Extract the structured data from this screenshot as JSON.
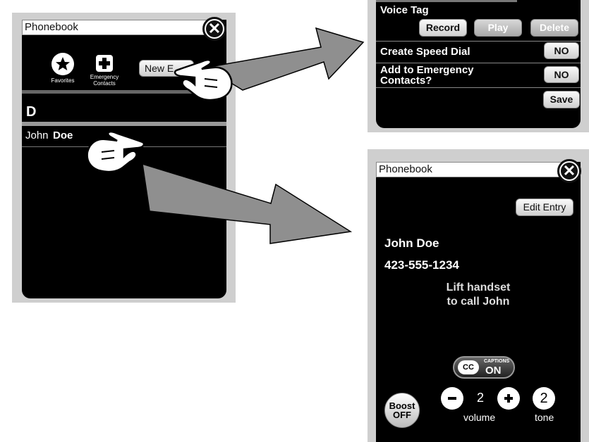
{
  "left_panel": {
    "title": "Phonebook",
    "favorites_label": "Favorites",
    "emergency_label": "Emergency Contacts",
    "new_entry_label": "New E",
    "section_letter": "D",
    "contact_first": "John",
    "contact_last": "Doe"
  },
  "top_right_panel": {
    "voice_tag_label": "Voice Tag",
    "record_label": "Record",
    "play_label": "Play",
    "delete_label": "Delete",
    "speed_dial_label": "Create Speed Dial",
    "speed_dial_value": "NO",
    "emergency_q_line1": "Add to Emergency",
    "emergency_q_line2": "Contacts?",
    "emergency_value": "NO",
    "save_label": "Save"
  },
  "bottom_right_panel": {
    "title": "Phonebook",
    "edit_entry_label": "Edit Entry",
    "contact_name": "John Doe",
    "phone_number": "423-555-1234",
    "message_line1": "Lift handset",
    "message_line2": "to call John",
    "captions_small": "CAPTIONS",
    "captions_cc": "CC",
    "captions_on": "ON",
    "boost_line1": "Boost",
    "boost_line2": "OFF",
    "volume_value": "2",
    "volume_label": "volume",
    "tone_value": "2",
    "tone_label": "tone"
  },
  "colors": {
    "screen": "#000000",
    "frame": "#cfcfcf",
    "arrow": "#8f8f8f"
  }
}
